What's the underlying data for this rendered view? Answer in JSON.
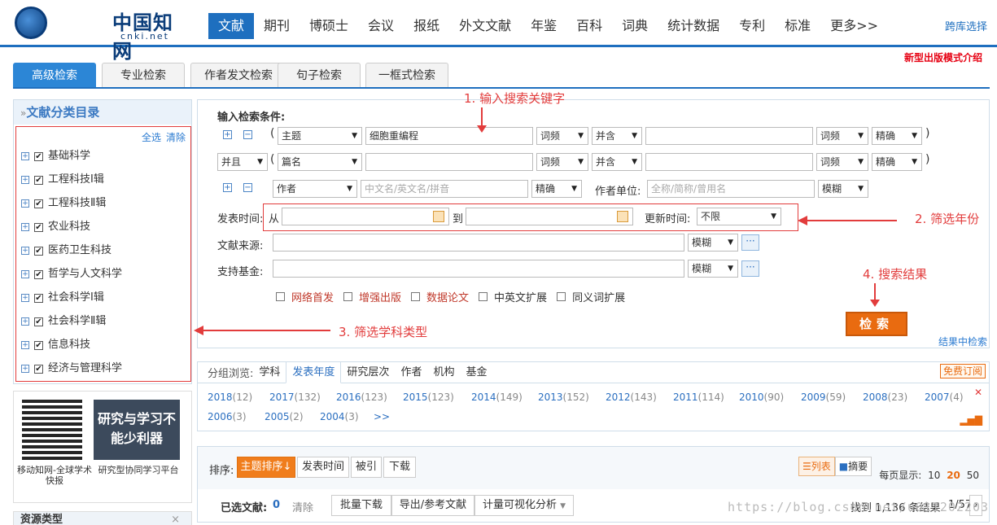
{
  "header": {
    "logo_zh": "中国知网",
    "logo_latin": "CNKi",
    "logo_url": "cnki.net",
    "nav": [
      "文献",
      "期刊",
      "博硕士",
      "会议",
      "报纸",
      "外文文献",
      "年鉴",
      "百科",
      "词典",
      "统计数据",
      "专利",
      "标准",
      "更多>>"
    ],
    "cross_lib": "跨库选择",
    "new_mode": "新型出版模式介绍"
  },
  "search_tabs": [
    "高级检索",
    "专业检索",
    "作者发文检索",
    "句子检索",
    "一框式检索"
  ],
  "left": {
    "title": "文献分类目录",
    "select_all": "全选",
    "clear": "清除",
    "categories": [
      "基础科学",
      "工程科技Ⅰ辑",
      "工程科技Ⅱ辑",
      "农业科技",
      "医药卫生科技",
      "哲学与人文科学",
      "社会科学Ⅰ辑",
      "社会科学Ⅱ辑",
      "信息科技",
      "经济与管理科学"
    ]
  },
  "promo": {
    "qr_caption": "移动知网-全球学术快报",
    "banner": "研究与学习不能少利器",
    "banner_caption": "研究型协同学习平台"
  },
  "resource_type": "资源类型",
  "form": {
    "title": "输入检索条件:",
    "row1": {
      "field": "主题",
      "value": "细胞重编程",
      "freq": "词频",
      "logic": "并含",
      "freq2": "词频",
      "match": "精确"
    },
    "row2": {
      "bool": "并且",
      "field": "篇名",
      "freq": "词频",
      "logic": "并含",
      "freq2": "词频",
      "match": "精确"
    },
    "row3": {
      "field": "作者",
      "placeholder": "中文名/英文名/拼音",
      "match": "精确",
      "unit_label": "作者单位:",
      "unit_placeholder": "全称/简称/曾用名",
      "unit_match": "模糊"
    },
    "time_label": "发表时间:",
    "from": "从",
    "to": "到",
    "update_label": "更新时间:",
    "update_value": "不限",
    "source_label": "文献来源:",
    "source_match": "模糊",
    "fund_label": "支持基金:",
    "fund_match": "模糊",
    "checkboxes": [
      "网络首发",
      "增强出版",
      "数据论文",
      "中英文扩展",
      "同义词扩展"
    ],
    "search_btn": "检索",
    "search_in_result": "结果中检索"
  },
  "annotations": {
    "a1": "1. 输入搜索关键字",
    "a2": "2. 筛选年份",
    "a3": "3. 筛选学科类型",
    "a4": "4. 搜索结果"
  },
  "group": {
    "label": "分组浏览:",
    "tabs": [
      "学科",
      "发表年度",
      "研究层次",
      "作者",
      "机构",
      "基金"
    ],
    "free_sub": "免费订阅",
    "years": [
      {
        "y": "2018",
        "c": "(12)"
      },
      {
        "y": "2017",
        "c": "(132)"
      },
      {
        "y": "2016",
        "c": "(123)"
      },
      {
        "y": "2015",
        "c": "(123)"
      },
      {
        "y": "2014",
        "c": "(149)"
      },
      {
        "y": "2013",
        "c": "(152)"
      },
      {
        "y": "2012",
        "c": "(143)"
      },
      {
        "y": "2011",
        "c": "(114)"
      },
      {
        "y": "2010",
        "c": "(90)"
      },
      {
        "y": "2009",
        "c": "(59)"
      },
      {
        "y": "2008",
        "c": "(23)"
      },
      {
        "y": "2007",
        "c": "(4)"
      },
      {
        "y": "2006",
        "c": "(3)"
      },
      {
        "y": "2005",
        "c": "(2)"
      },
      {
        "y": "2004",
        "c": "(3)"
      },
      {
        "y": ">>",
        "c": ""
      }
    ]
  },
  "sort": {
    "label": "排序:",
    "buttons": [
      "主题排序↓",
      "发表时间",
      "被引",
      "下载"
    ],
    "view_list": "列表",
    "view_abstract": "摘要",
    "per_page_label": "每页显示:",
    "per_page": [
      "10",
      "20",
      "50"
    ],
    "selected_label": "已选文献:",
    "selected_count": "0",
    "clear": "清除",
    "actions": [
      "批量下载",
      "导出/参考文献",
      "计量可视化分析"
    ],
    "found": "找到 1,136 条结果",
    "page": "1/57"
  },
  "watermark": "https://blog.csdn.net/u011202203"
}
